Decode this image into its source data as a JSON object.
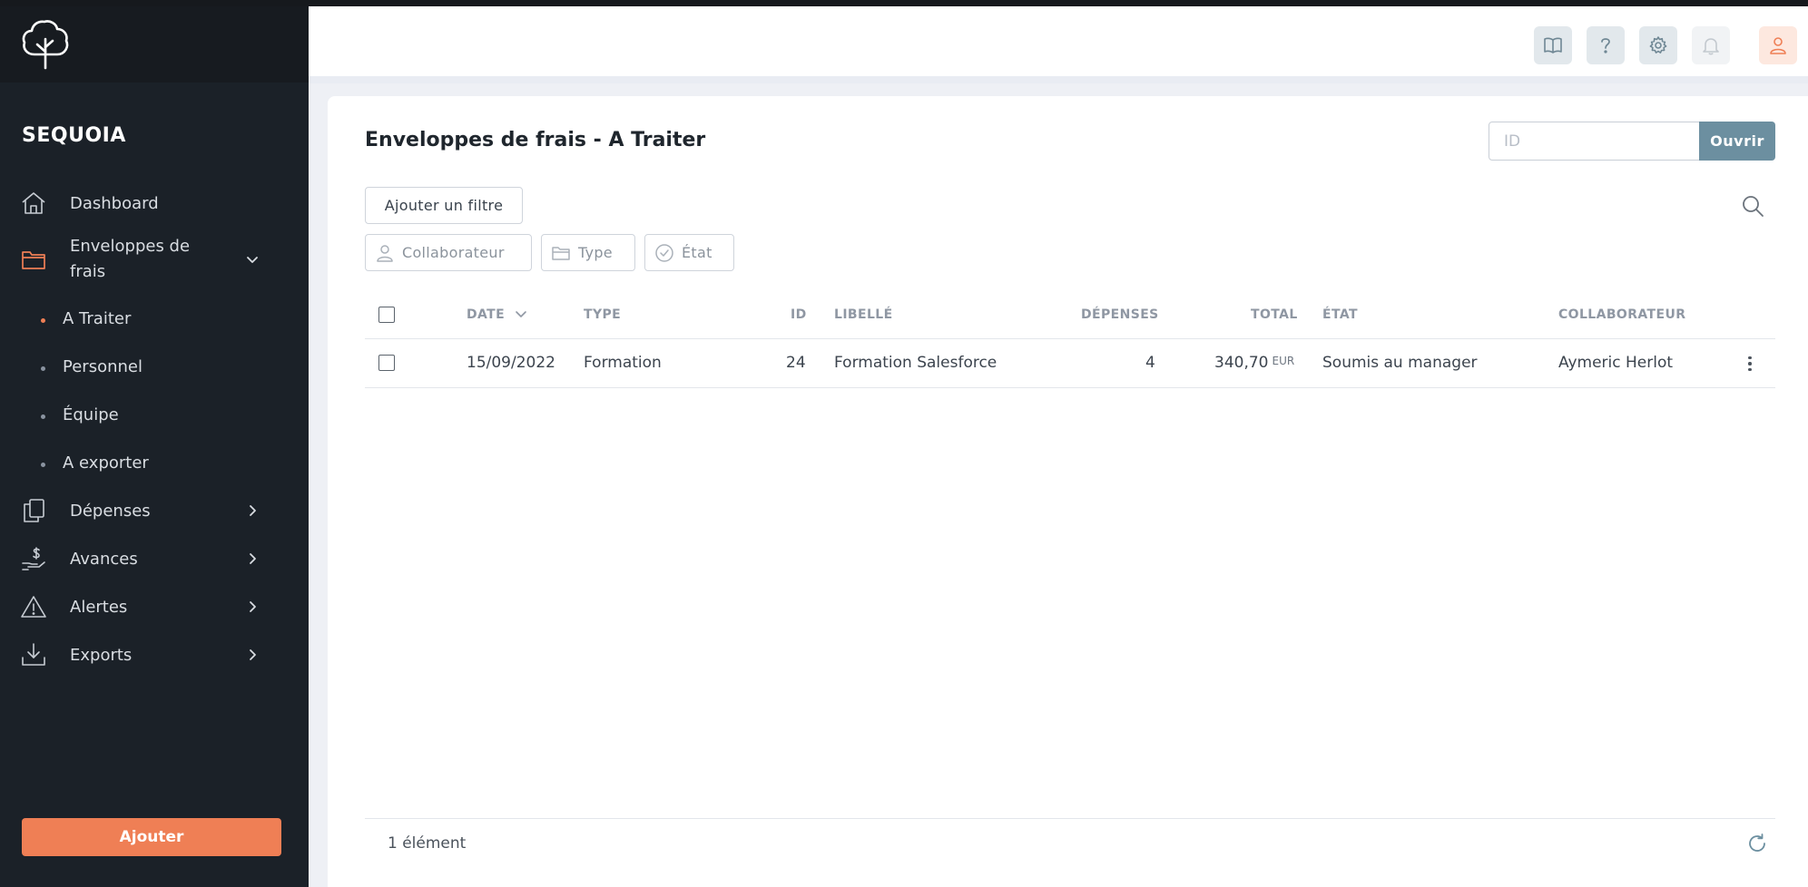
{
  "brand": "SEQUOIA",
  "sidebar": {
    "items": [
      {
        "label": "Dashboard",
        "icon": "home-icon"
      },
      {
        "label": "Enveloppes de frais",
        "icon": "folder-icon",
        "expanded": true
      },
      {
        "label": "Dépenses",
        "icon": "documents-icon"
      },
      {
        "label": "Avances",
        "icon": "cash-hand-icon"
      },
      {
        "label": "Alertes",
        "icon": "warning-icon"
      },
      {
        "label": "Exports",
        "icon": "download-icon"
      }
    ],
    "sub_items": [
      {
        "label": "A Traiter",
        "active": true
      },
      {
        "label": "Personnel"
      },
      {
        "label": "Équipe"
      },
      {
        "label": "A exporter"
      }
    ],
    "add_label": "Ajouter"
  },
  "header": {
    "icons": [
      "book-icon",
      "help-icon",
      "gear-icon",
      "bell-icon",
      "user-icon"
    ]
  },
  "page": {
    "title": "Enveloppes de frais - A Traiter",
    "id_placeholder": "ID",
    "open_label": "Ouvrir",
    "add_filter_label": "Ajouter un filtre",
    "chips": [
      "Collaborateur",
      "Type",
      "État"
    ]
  },
  "table": {
    "headers": [
      "DATE",
      "TYPE",
      "ID",
      "LIBELLÉ",
      "DÉPENSES",
      "TOTAL",
      "ÉTAT",
      "COLLABORATEUR"
    ],
    "rows": [
      {
        "date": "15/09/2022",
        "type": "Formation",
        "id": "24",
        "libelle": "Formation Salesforce",
        "depenses": "4",
        "total": "340,70",
        "currency": "EUR",
        "etat": "Soumis au manager",
        "collaborateur": "Aymeric Herlot"
      }
    ],
    "count_label": "1 élément"
  },
  "colors": {
    "accent": "#ef7f55",
    "sidebar_bg": "#1b2128",
    "open_button": "#6c8fa0"
  }
}
